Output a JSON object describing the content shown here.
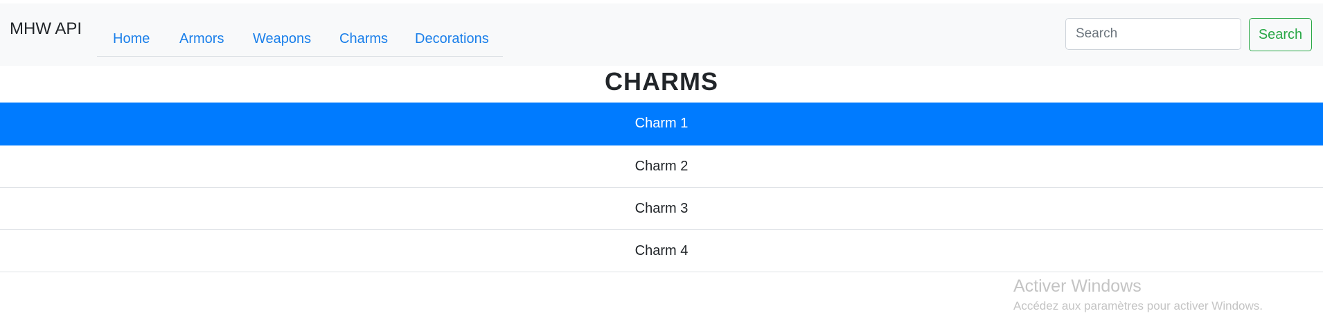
{
  "header": {
    "brand": "MHW API",
    "nav": [
      {
        "label": "Home"
      },
      {
        "label": "Armors"
      },
      {
        "label": "Weapons"
      },
      {
        "label": "Charms"
      },
      {
        "label": "Decorations"
      }
    ],
    "search": {
      "placeholder": "Search",
      "value": "",
      "button_label": "Search"
    }
  },
  "main": {
    "title": "CHARMS",
    "items": [
      {
        "label": "Charm 1",
        "active": true
      },
      {
        "label": "Charm 2",
        "active": false
      },
      {
        "label": "Charm 3",
        "active": false
      },
      {
        "label": "Charm 4",
        "active": false
      }
    ]
  },
  "watermark": {
    "title": "Activer Windows",
    "subtitle": "Accédez aux paramètres pour activer Windows."
  },
  "colors": {
    "active_item": "#007bff",
    "nav_link": "#1a7fea",
    "search_button": "#28a745",
    "topbar_bg": "#f8f9fa"
  }
}
